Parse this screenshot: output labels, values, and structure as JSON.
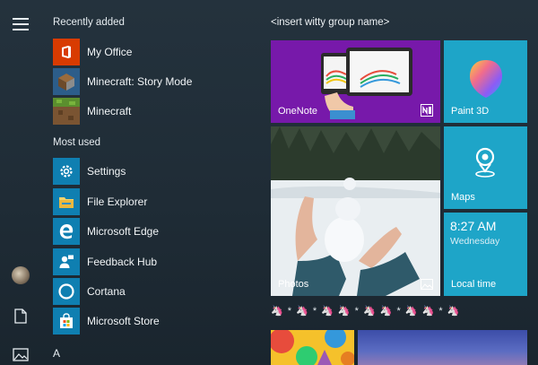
{
  "sections": {
    "recently_added": "Recently added",
    "most_used": "Most used",
    "letter": "A"
  },
  "recently_added": [
    {
      "label": "My Office",
      "icon": "office-icon"
    },
    {
      "label": "Minecraft: Story Mode",
      "icon": "minecraft-story-mode-icon"
    },
    {
      "label": "Minecraft",
      "icon": "minecraft-icon"
    }
  ],
  "most_used": [
    {
      "label": "Settings",
      "icon": "gear-icon"
    },
    {
      "label": "File Explorer",
      "icon": "folder-icon"
    },
    {
      "label": "Microsoft Edge",
      "icon": "edge-icon"
    },
    {
      "label": "Feedback Hub",
      "icon": "feedback-hub-icon"
    },
    {
      "label": "Cortana",
      "icon": "cortana-icon"
    },
    {
      "label": "Microsoft Store",
      "icon": "store-icon"
    }
  ],
  "group": {
    "title": "<insert witty group name>"
  },
  "tiles": {
    "onenote": "OneNote",
    "paint3d": "Paint 3D",
    "photos": "Photos",
    "maps": "Maps",
    "calendar_time": "8:27 AM",
    "calendar_day": "Wednesday",
    "calendar_label": "Local time"
  },
  "emoji_row": "🦄 * 🦄 * 🦄 🦄 * 🦄 🦄 * 🦄 🦄 * 🦄",
  "colors": {
    "onenote": "#7719aa",
    "accent_blue": "#1ea5c8",
    "office": "#d83b01"
  }
}
